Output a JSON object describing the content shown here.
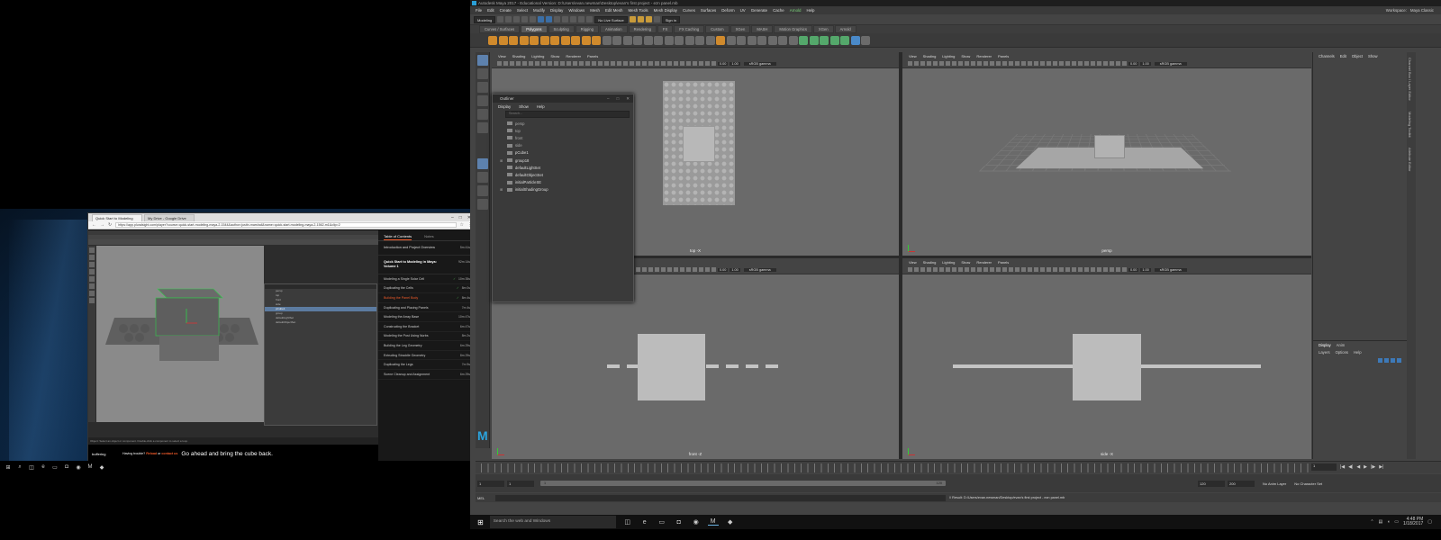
{
  "browser": {
    "tabs": [
      {
        "label": "Quick Start to Modeling"
      },
      {
        "label": "My Drive - Google Drive"
      }
    ],
    "url": "https://app.pluralsight.com/player?course=quick-start-modeling-maya-2-1544&author=justin-marshall&name=quick-start-modeling-maya-2-1562-m1&clip=2"
  },
  "video": {
    "outliner_rows": [
      {
        "label": "persp"
      },
      {
        "label": "top"
      },
      {
        "label": "front"
      },
      {
        "label": "side"
      },
      {
        "label": "pCube1",
        "selected": true
      },
      {
        "label": "group"
      },
      {
        "label": "defaultLightSet"
      },
      {
        "label": "defaultObjectSet"
      }
    ],
    "status": "Object: Select an object or component. Double-click a component to select a loop.",
    "caption_speaker": "buffering",
    "caption_trouble_prefix": "Having trouble?",
    "caption_trouble_link1": "Reload",
    "caption_trouble_or": "or",
    "caption_trouble_link2": "contact us",
    "caption_text": "Go ahead and bring the cube back."
  },
  "toc": {
    "tab_contents": "Table of Contents",
    "tab_notes": "Notes",
    "modules": [
      {
        "name": "Introduction and Project Overview",
        "duration": "5m 41s",
        "current": false
      },
      {
        "name": "Quick Start to Modeling in Maya: Volume 1",
        "duration": "92m 14s",
        "current": true
      }
    ],
    "clips": [
      {
        "name": "Modeling a Single Solar Cell",
        "duration": "10m 35s",
        "done": true,
        "active": false
      },
      {
        "name": "Duplicating the Cells",
        "duration": "8m 0s",
        "done": true,
        "active": false
      },
      {
        "name": "Building the Panel Body",
        "duration": "8m 4s",
        "done": true,
        "active": true
      },
      {
        "name": "Duplicating and Placing Panels",
        "duration": "7m 4s",
        "done": false,
        "active": false
      },
      {
        "name": "Modeling the Array Base",
        "duration": "10m 47s",
        "done": false,
        "active": false
      },
      {
        "name": "Constructing the Bracket",
        "duration": "6m 47s",
        "done": false,
        "active": false
      },
      {
        "name": "Modeling the Post Using Nurbs",
        "duration": "8m 2s",
        "done": false,
        "active": false
      },
      {
        "name": "Building the Leg Geometry",
        "duration": "6m 29s",
        "done": false,
        "active": false
      },
      {
        "name": "Extruding Straddle Geometry",
        "duration": "8m 29s",
        "done": false,
        "active": false
      },
      {
        "name": "Duplicating the Legs",
        "duration": "7m 9s",
        "done": false,
        "active": false
      },
      {
        "name": "Scene Cleanup and Assignment",
        "duration": "6m 29s",
        "done": false,
        "active": false
      }
    ]
  },
  "maya": {
    "title": "Autodesk Maya 2017 - Educational Version: D:\\Users\\evan.newman\\Desktop\\evan's first project - ezn panel.mb",
    "menus": [
      "File",
      "Edit",
      "Create",
      "Select",
      "Modify",
      "Display",
      "Windows",
      "Mesh",
      "Edit Mesh",
      "Mesh Tools",
      "Mesh Display",
      "Curves",
      "Surfaces",
      "Deform",
      "UV",
      "Generate",
      "Cache",
      "Arnold",
      "Help"
    ],
    "workspace_label": "Workspace:",
    "workspace_value": "Maya Classic",
    "mode_dropdown": "Modeling",
    "live_surface": "No Live Surface",
    "signin": "Sign in",
    "shelf_tabs": [
      "Curves / Surfaces",
      "Polygons",
      "Sculpting",
      "Rigging",
      "Animation",
      "Rendering",
      "FX",
      "FX Caching",
      "Custom",
      "XGen",
      "MASH",
      "Motion Graphics",
      "XGen",
      "Arnold"
    ],
    "active_shelf": "Polygons",
    "viewport_menus": [
      "View",
      "Shading",
      "Lighting",
      "Show",
      "Renderer",
      "Panels"
    ],
    "viewports": {
      "top": {
        "label": "top -X",
        "near": "0.00",
        "far": "1.00",
        "gamma": "sRGB gamma"
      },
      "persp": {
        "label": "persp",
        "near": "0.00",
        "far": "1.00",
        "gamma": "sRGB gamma"
      },
      "front": {
        "label": "front -Z",
        "near": "0.00",
        "far": "1.00",
        "gamma": "sRGB gamma"
      },
      "side": {
        "label": "side -X",
        "near": "0.00",
        "far": "1.00",
        "gamma": "sRGB gamma"
      }
    },
    "outliner": {
      "title": "Outliner",
      "menus": [
        "Display",
        "Show",
        "Help"
      ],
      "search_placeholder": "Search...",
      "items": [
        {
          "label": "persp",
          "expandable": false,
          "dim": true
        },
        {
          "label": "top",
          "expandable": false,
          "dim": true
        },
        {
          "label": "front",
          "expandable": false,
          "dim": true
        },
        {
          "label": "side",
          "expandable": false,
          "dim": true
        },
        {
          "label": "pCube1",
          "expandable": false,
          "dim": false
        },
        {
          "label": "group18",
          "expandable": true,
          "dim": false
        },
        {
          "label": "defaultLightSet",
          "expandable": false,
          "dim": false
        },
        {
          "label": "defaultObjectSet",
          "expandable": false,
          "dim": false
        },
        {
          "label": "initialParticleSE",
          "expandable": false,
          "dim": false
        },
        {
          "label": "initialShadingGroup",
          "expandable": true,
          "dim": false
        }
      ]
    },
    "channelbox_menus": [
      "Channels",
      "Edit",
      "Object",
      "Show"
    ],
    "layer_tabs": [
      "Display",
      "Anim"
    ],
    "layer_menus": [
      "Layers",
      "Options",
      "Help"
    ],
    "side_tabs": [
      "Channel Box / Layer Editor",
      "Modeling Toolkit",
      "Attribute Editor"
    ],
    "time": {
      "current_frame": "1",
      "range_start": "1",
      "range_start_inner": "1",
      "range_bar_start": "1",
      "range_bar_end": "120",
      "range_end_inner": "120",
      "range_end": "200",
      "anim_layer": "No Anim Layer",
      "character_set": "No Character Set"
    },
    "cmd_label": "MEL",
    "cmd_result": "// Result: D:/Users/evan.newman/Desktop/evan's first project - ezn panel.mb"
  },
  "taskbar": {
    "search_placeholder": "Search the web and Windows",
    "time": "4:48 PM",
    "date": "1/18/2017"
  }
}
